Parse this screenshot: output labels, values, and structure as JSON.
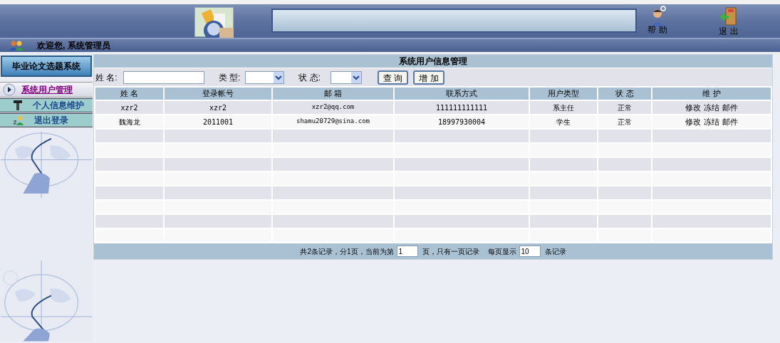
{
  "header": {
    "help_label": "帮 助",
    "exit_label": "退 出"
  },
  "welcome": "欢迎您, 系统管理员",
  "sidebar": {
    "title": "毕业论文选题系统",
    "items": [
      {
        "label": "系统用户管理",
        "selected": true
      },
      {
        "label": "个人信息维护",
        "selected": false
      },
      {
        "label": "退出登录",
        "selected": false
      }
    ]
  },
  "panel": {
    "title": "系统用户信息管理",
    "filters": {
      "name_label": "姓 名:",
      "type_label": "类 型:",
      "status_label": "状 态:"
    },
    "buttons": [
      "查 询",
      "增 加"
    ]
  },
  "table": {
    "columns": [
      "姓 名",
      "登录帐号",
      "邮 箱",
      "联系方式",
      "用户类型",
      "状 态",
      "维 护"
    ],
    "rows": [
      {
        "cells": [
          "xzr2",
          "xzr2",
          "xzr2@qq.com",
          "111111111111",
          "系主任",
          "正常"
        ],
        "actions": [
          "修改",
          "冻结",
          "邮件"
        ]
      },
      {
        "cells": [
          "魏海龙",
          "2011001",
          "shamu20729@sina.com",
          "18997930004",
          "学生",
          "正常"
        ],
        "actions": [
          "修改",
          "冻结",
          "邮件"
        ]
      }
    ]
  },
  "pagination": {
    "before": "共2条记录，分1页，当前为第",
    "page": "1",
    "middle": "页，只有一页记录",
    "per_page_label": "每页显示",
    "per_page": "10",
    "after": "条记录"
  }
}
